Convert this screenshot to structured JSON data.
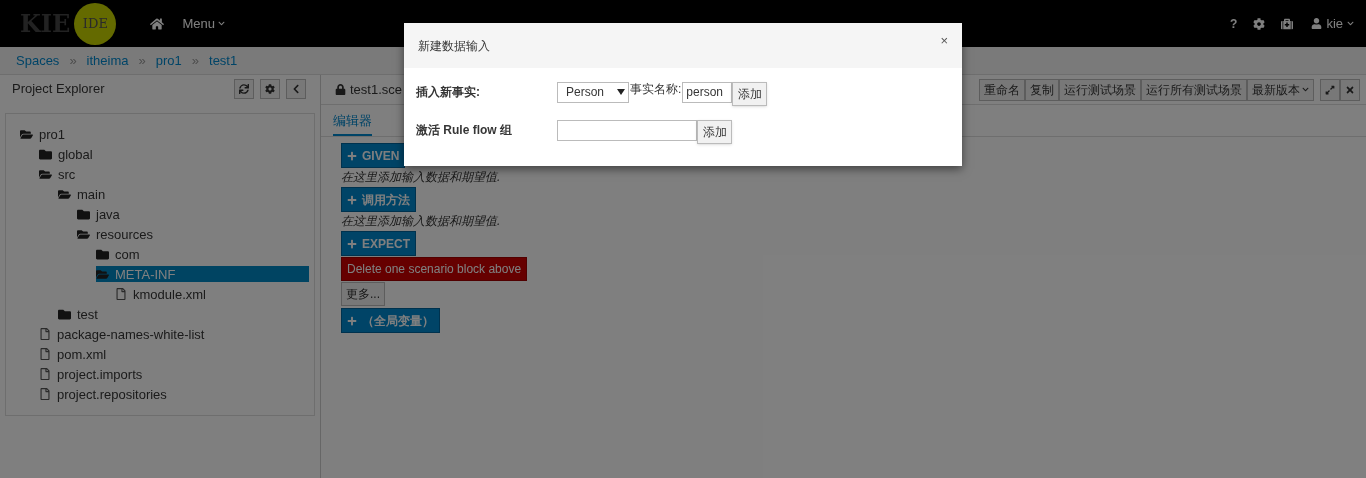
{
  "navbar": {
    "logo_text": "KIE",
    "logo_badge": "IDE",
    "menu": "Menu",
    "help": "?",
    "user": "kie"
  },
  "breadcrumbs": [
    {
      "label": "Spaces"
    },
    {
      "separator": "»",
      "label": "itheima"
    },
    {
      "separator": "»",
      "label": "pro1"
    },
    {
      "separator": "»",
      "label": "test1"
    }
  ],
  "explorer": {
    "title": "Project Explorer",
    "tree": [
      {
        "label": "pro1",
        "kind": "folder",
        "expanded": true,
        "selected": false,
        "children": [
          {
            "label": "global",
            "kind": "folder",
            "expanded": false,
            "selected": false
          },
          {
            "label": "src",
            "kind": "folder",
            "expanded": true,
            "selected": false,
            "children": [
              {
                "label": "main",
                "kind": "folder",
                "expanded": true,
                "selected": false,
                "children": [
                  {
                    "label": "java",
                    "kind": "folder",
                    "expanded": false,
                    "selected": false
                  },
                  {
                    "label": "resources",
                    "kind": "folder",
                    "expanded": true,
                    "selected": false,
                    "children": [
                      {
                        "label": "com",
                        "kind": "folder",
                        "expanded": false,
                        "selected": false
                      },
                      {
                        "label": "META-INF",
                        "kind": "folder",
                        "expanded": true,
                        "selected": true,
                        "children": [
                          {
                            "label": "kmodule.xml",
                            "kind": "file",
                            "selected": false
                          }
                        ]
                      }
                    ]
                  }
                ]
              },
              {
                "label": "test",
                "kind": "folder",
                "expanded": false,
                "selected": false
              }
            ]
          },
          {
            "label": "package-names-white-list",
            "kind": "file",
            "selected": false
          },
          {
            "label": "pom.xml",
            "kind": "file",
            "selected": false
          },
          {
            "label": "project.imports",
            "kind": "file",
            "selected": false
          },
          {
            "label": "project.repositories",
            "kind": "file",
            "selected": false
          }
        ]
      }
    ]
  },
  "editor": {
    "file_title": "test1.sce",
    "tabs": [
      {
        "label": "编辑器",
        "selected": true
      }
    ],
    "toolbar": [
      {
        "label": "重命名",
        "dropdown": false
      },
      {
        "label": "复制",
        "dropdown": false
      },
      {
        "label": "运行测试场景",
        "dropdown": false
      },
      {
        "label": "运行所有测试场景",
        "dropdown": false
      },
      {
        "label": "最新版本",
        "dropdown": true
      }
    ],
    "blocks": [
      {
        "kind": "add",
        "label": "GIVEN"
      },
      {
        "kind": "hint",
        "label": "在这里添加输入数据和期望值."
      },
      {
        "kind": "add",
        "label": "调用方法"
      },
      {
        "kind": "hint",
        "label": "在这里添加输入数据和期望值."
      },
      {
        "kind": "add",
        "label": "EXPECT"
      },
      {
        "kind": "delete",
        "label": "Delete one scenario block above"
      },
      {
        "kind": "more",
        "label": "更多..."
      },
      {
        "kind": "add",
        "label": "（全局变量）"
      }
    ]
  },
  "dialog": {
    "title": "新建数据输入",
    "close": "×",
    "insert_fact": {
      "label": "插入新事实:",
      "select_value": "Person",
      "name_label": "事实名称:",
      "name_value": "person",
      "button": "添加"
    },
    "rule_flow": {
      "label": "激活 Rule flow 组",
      "button": "添加"
    }
  }
}
